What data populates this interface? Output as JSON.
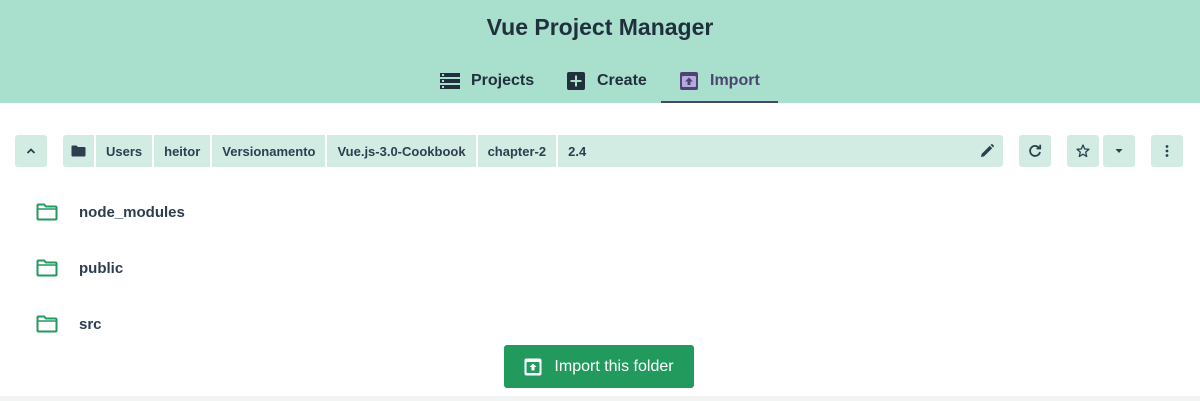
{
  "app": {
    "title": "Vue Project Manager"
  },
  "tabs": [
    {
      "label": "Projects",
      "icon": "list-icon",
      "active": false
    },
    {
      "label": "Create",
      "icon": "plus-box-icon",
      "active": false
    },
    {
      "label": "Import",
      "icon": "unarchive-icon",
      "active": true
    }
  ],
  "toolbar": {
    "up_icon": "chevron-up-icon",
    "root_icon": "folder-icon",
    "breadcrumbs": [
      "Users",
      "heitor",
      "Versionamento",
      "Vue.js-3.0-Cookbook",
      "chapter-2",
      "2.4"
    ],
    "edit_icon": "pencil-icon",
    "refresh_icon": "refresh-icon",
    "favorite_icon": "star-outline-icon",
    "favorites_menu_icon": "caret-down-icon",
    "more_icon": "more-vertical-icon"
  },
  "folders": [
    {
      "name": "node_modules",
      "icon": "folder-outline-icon"
    },
    {
      "name": "public",
      "icon": "folder-outline-icon"
    },
    {
      "name": "src",
      "icon": "folder-outline-icon"
    }
  ],
  "import_button": {
    "label": "Import this folder",
    "icon": "unarchive-icon"
  },
  "colors": {
    "header_bg": "#a9dfcd",
    "toolbar_bg": "#d3ece3",
    "accent_green": "#229a5e",
    "active_tab": "#4c4570",
    "text": "#2c3e50"
  }
}
